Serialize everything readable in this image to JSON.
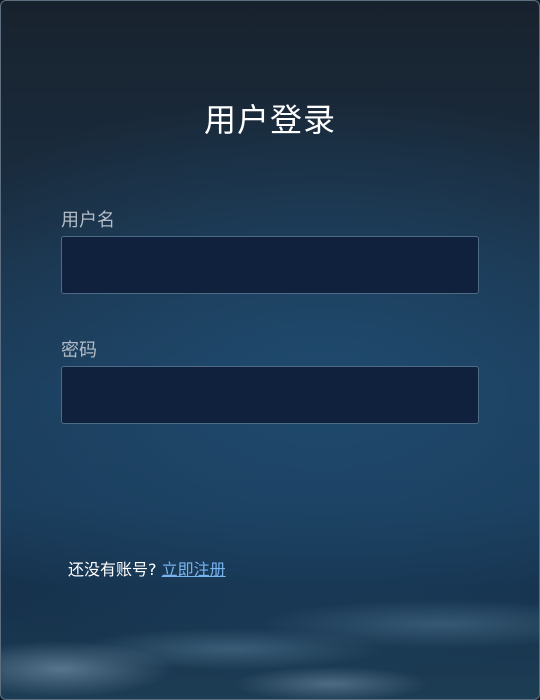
{
  "login": {
    "title": "用户登录",
    "username_label": "用户名",
    "username_value": "",
    "password_label": "密码",
    "password_value": "",
    "signup_prompt": "还没有账号?",
    "signup_link": "立即注册"
  },
  "colors": {
    "title": "#ffffff",
    "label": "#b3bcc6",
    "input_bg": "#10213d",
    "input_border": "#4f6a86",
    "link": "#78b4f0"
  }
}
